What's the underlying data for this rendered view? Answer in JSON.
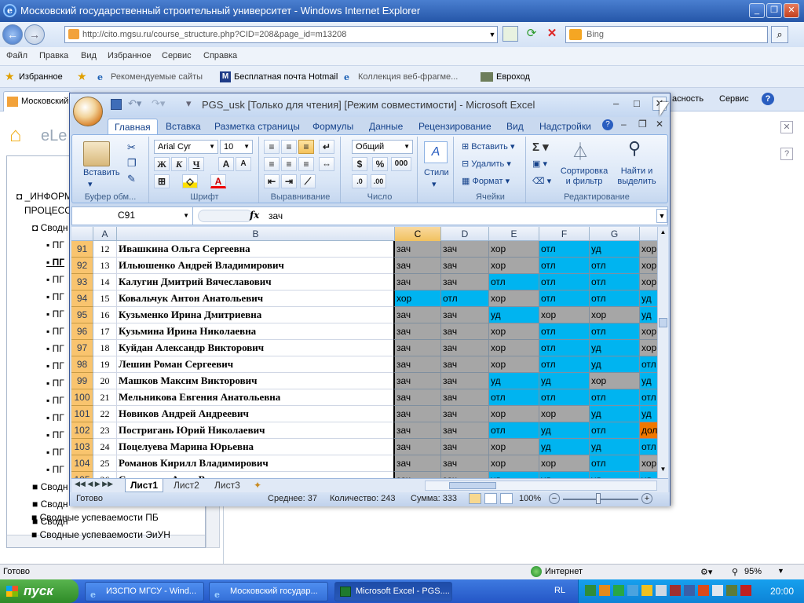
{
  "ie": {
    "title": "Московский государственный строительный университет - Windows Internet Explorer",
    "url": "http://cito.mgsu.ru/course_structure.php?CID=208&page_id=m13208",
    "search_placeholder": "Bing",
    "menu": [
      "Файл",
      "Правка",
      "Вид",
      "Избранное",
      "Сервис",
      "Справка"
    ],
    "favorites_label": "Избранное",
    "favorites": [
      "Рекомендуемые сайты",
      "Бесплатная почта Hotmail",
      "Коллекция веб-фрагме...",
      "Евроход"
    ],
    "tab_label": "Московский",
    "tab_right": [
      "асность",
      "Сервис"
    ],
    "status_left": "Готово",
    "status_zone": "Интернет",
    "zoom": "95%"
  },
  "webpage": {
    "logo": "eLe",
    "tree": {
      "root1": "_ИНФОРМ",
      "root2": "ПРОЦЕСС",
      "node": "Сводн",
      "leaves": [
        "ПГ",
        "ПГ",
        "ПГ",
        "ПГ",
        "ПГ",
        "ПГ",
        "ПГ",
        "ПГ",
        "ПГ",
        "ПГ",
        "ПГ",
        "ПГ",
        "ПГ",
        "ПГ"
      ],
      "bottom": [
        "Сводн",
        "Сводн",
        "Сводн",
        "Сводные успеваемости ПБ",
        "Сводные успеваемости ЭиУН"
      ]
    }
  },
  "excel": {
    "title": "PGS_usk  [Только для чтения]  [Режим совместимости] - Microsoft Excel",
    "tabs": [
      "Главная",
      "Вставка",
      "Разметка страницы",
      "Формулы",
      "Данные",
      "Рецензирование",
      "Вид",
      "Надстройки"
    ],
    "ribbon": {
      "paste": "Вставить",
      "clipboard": "Буфер обм...",
      "font_name": "Arial Cyr",
      "font_size": "10",
      "font_group": "Шрифт",
      "align_group": "Выравнивание",
      "number_format": "Общий",
      "number_group": "Число",
      "styles": "Стили",
      "insert": "Вставить",
      "delete": "Удалить",
      "format": "Формат",
      "cells_group": "Ячейки",
      "sort": "Сортировка и фильтр",
      "find": "Найти и выделить",
      "edit_group": "Редактирование"
    },
    "name_box": "C91",
    "formula": "зач",
    "columns": [
      "A",
      "B",
      "C",
      "D",
      "E",
      "F",
      "G"
    ],
    "rows": [
      {
        "r": "91",
        "a": "12",
        "b": "Ивашкина Ольга Сергеевна",
        "v": [
          "зач",
          "зач",
          "хор",
          "отл",
          "уд",
          "хор"
        ]
      },
      {
        "r": "92",
        "a": "13",
        "b": "Ильюшенко Андрей Владимирович",
        "v": [
          "зач",
          "зач",
          "хор",
          "отл",
          "отл",
          "хор"
        ]
      },
      {
        "r": "93",
        "a": "14",
        "b": "Калугин Дмитрий Вячеславович",
        "v": [
          "зач",
          "зач",
          "отл",
          "отл",
          "отл",
          "хор"
        ]
      },
      {
        "r": "94",
        "a": "15",
        "b": "Ковальчук Антон Анатольевич",
        "v": [
          "хор",
          "отл",
          "хор",
          "отл",
          "отл",
          "уд"
        ]
      },
      {
        "r": "95",
        "a": "16",
        "b": "Кузьменко Ирина Дмитриевна",
        "v": [
          "зач",
          "зач",
          "уд",
          "хор",
          "хор",
          "уд"
        ]
      },
      {
        "r": "96",
        "a": "17",
        "b": "Кузьмина Ирина Николаевна",
        "v": [
          "зач",
          "зач",
          "хор",
          "отл",
          "отл",
          "хор"
        ]
      },
      {
        "r": "97",
        "a": "18",
        "b": "Куйдан  Александр Викторович",
        "v": [
          "зач",
          "зач",
          "хор",
          "отл",
          "уд",
          "хор"
        ]
      },
      {
        "r": "98",
        "a": "19",
        "b": "Лешин Роман Сергеевич",
        "v": [
          "зач",
          "зач",
          "хор",
          "отл",
          "уд",
          "отл"
        ]
      },
      {
        "r": "99",
        "a": "20",
        "b": "Машков Максим Викторович",
        "v": [
          "зач",
          "зач",
          "уд",
          "уд",
          "хор",
          "уд"
        ]
      },
      {
        "r": "100",
        "a": "21",
        "b": "Мельникова Евгения Анатольевна",
        "v": [
          "зач",
          "зач",
          "отл",
          "отл",
          "отл",
          "отл"
        ]
      },
      {
        "r": "101",
        "a": "22",
        "b": "Новиков Андрей Андреевич",
        "v": [
          "зач",
          "зач",
          "хор",
          "хор",
          "уд",
          "уд"
        ]
      },
      {
        "r": "102",
        "a": "23",
        "b": "Постригань Юрий Николаевич",
        "v": [
          "зач",
          "зач",
          "отл",
          "уд",
          "отл",
          "дол"
        ]
      },
      {
        "r": "103",
        "a": "24",
        "b": "Поцелуева Марина Юрьевна",
        "v": [
          "зач",
          "зач",
          "хор",
          "уд",
          "уд",
          "отл"
        ]
      },
      {
        "r": "104",
        "a": "25",
        "b": "Романов Кирилл Владимирович",
        "v": [
          "зач",
          "зач",
          "хор",
          "хор",
          "отл",
          "хор"
        ]
      },
      {
        "r": "105",
        "a": "26",
        "b": "Самсонова Анна Васильевна",
        "v": [
          "зач",
          "зач",
          "уд",
          "уд",
          "уд",
          "уд"
        ]
      }
    ],
    "sheets": [
      "Лист1",
      "Лист2",
      "Лист3"
    ],
    "status": {
      "ready": "Готово",
      "avg": "Среднее: 37",
      "count": "Количество: 243",
      "sum": "Сумма: 333",
      "zoom": "100%"
    }
  },
  "taskbar": {
    "start": "пуск",
    "items": [
      "ИЗСПО МГСУ - Wind...",
      "Московский государ...",
      "Microsoft Excel - PGS...."
    ],
    "lang": "RL",
    "clock": "20:00"
  },
  "colors": {
    "cyan": "#00b4f0",
    "gray": "#a6a6a6",
    "orange": "#f07800",
    "rowhdr": "#f9c46e"
  }
}
